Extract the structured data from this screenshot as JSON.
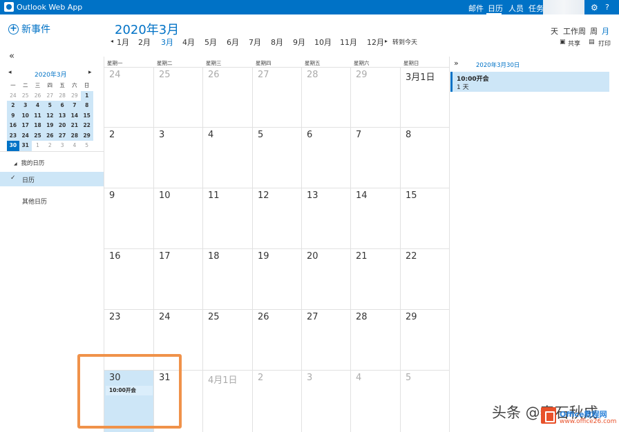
{
  "topbar": {
    "app_title": "Outlook Web App",
    "nav": [
      "邮件",
      "日历",
      "人员",
      "任务"
    ],
    "active_nav": "日历",
    "icons": [
      "gear-icon",
      "help-icon"
    ],
    "brand_color": "#0072c6"
  },
  "new_event": {
    "label": "新事件"
  },
  "header": {
    "title": "2020年3月",
    "months": [
      "1月",
      "2月",
      "3月",
      "4月",
      "5月",
      "6月",
      "7月",
      "8月",
      "9月",
      "10月",
      "11月",
      "12月"
    ],
    "active_month": "3月",
    "goto_today": "转到今天"
  },
  "views": {
    "day": "天",
    "work_week": "工作周",
    "week": "周",
    "month": "月",
    "active": "月",
    "share": "共享",
    "print": "打印"
  },
  "mini_cal": {
    "title": "2020年3月",
    "weekdays": [
      "一",
      "二",
      "三",
      "四",
      "五",
      "六",
      "日"
    ],
    "rows": [
      [
        "24",
        "25",
        "26",
        "27",
        "28",
        "29",
        "1"
      ],
      [
        "2",
        "3",
        "4",
        "5",
        "6",
        "7",
        "8"
      ],
      [
        "9",
        "10",
        "11",
        "12",
        "13",
        "14",
        "15"
      ],
      [
        "16",
        "17",
        "18",
        "19",
        "20",
        "21",
        "22"
      ],
      [
        "23",
        "24",
        "25",
        "26",
        "27",
        "28",
        "29"
      ],
      [
        "30",
        "31",
        "1",
        "2",
        "3",
        "4",
        "5"
      ]
    ]
  },
  "sidebar": {
    "my_calendars": "我的日历",
    "calendar": "日历",
    "other_calendars": "其他日历"
  },
  "grid": {
    "weekdays": [
      "星期一",
      "星期二",
      "星期三",
      "星期四",
      "星期五",
      "星期六",
      "星期日"
    ],
    "weeks": [
      [
        "24",
        "25",
        "26",
        "27",
        "28",
        "29",
        "3月1日"
      ],
      [
        "2",
        "3",
        "4",
        "5",
        "6",
        "7",
        "8"
      ],
      [
        "9",
        "10",
        "11",
        "12",
        "13",
        "14",
        "15"
      ],
      [
        "16",
        "17",
        "18",
        "19",
        "20",
        "21",
        "22"
      ],
      [
        "23",
        "24",
        "25",
        "26",
        "27",
        "28",
        "29"
      ],
      [
        "30",
        "31",
        "4月1日",
        "2",
        "3",
        "4",
        "5"
      ]
    ],
    "event_label": "10:00开会"
  },
  "agenda": {
    "date": "2020年3月30日",
    "event_title": "10:00开会",
    "event_duration": "1 天"
  },
  "watermark": {
    "text": "头条 @春石秋成",
    "brand": "Office教程网",
    "url": "www.office26.com"
  }
}
